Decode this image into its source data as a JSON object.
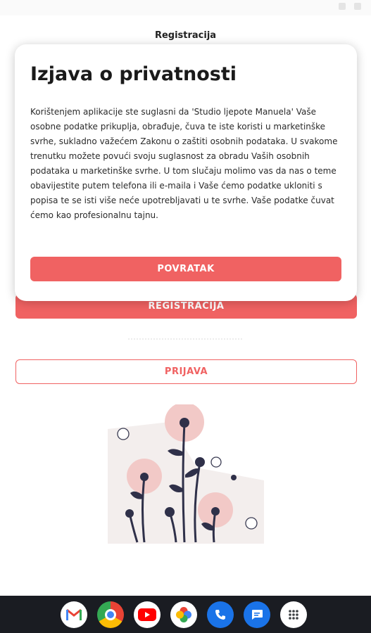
{
  "header": {
    "title": "Registracija"
  },
  "modal": {
    "title": "Izjava o privatnosti",
    "body": "Korištenjem aplikacije ste suglasni da 'Studio ljepote Manuela' Vaše osobne podatke prikuplja, obrađuje, čuva te iste koristi u marketinške svrhe, sukladno važećem Zakonu o zaštiti osobnih podataka. U svakome trenutku možete povući svoju suglasnost za obradu Vaših osobnih podataka u marketinške svrhe. U tom slučaju molimo vas da nas o teme obavijestite putem telefona ili e-maila i Vaše ćemo podatke ukloniti s popisa te se isti više neće upotrebljavati u te svrhe. Vaše podatke čuvat ćemo kao profesionalnu tajnu.",
    "back_label": "POVRATAK"
  },
  "form": {
    "register_label": "REGISTRACIJA",
    "login_label": "PRIJAVA"
  },
  "colors": {
    "accent": "#f06262",
    "dock": "#1a1c22"
  },
  "dock": {
    "apps": [
      "gmail-icon",
      "chrome-icon",
      "youtube-icon",
      "photos-icon",
      "phone-icon",
      "messages-icon",
      "app-drawer-icon"
    ]
  }
}
